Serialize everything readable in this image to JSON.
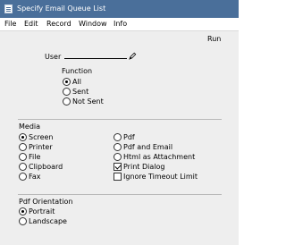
{
  "window": {
    "title": "Specify Email Queue List"
  },
  "menu": [
    "File",
    "Edit",
    "Record",
    "Window",
    "Info"
  ],
  "toolbar": {
    "run_label": "Run"
  },
  "user": {
    "label": "User",
    "value": ""
  },
  "function": {
    "label": "Function",
    "options": [
      "All",
      "Sent",
      "Not Sent"
    ],
    "selected": "All"
  },
  "media": {
    "label": "Media",
    "left_options": [
      "Screen",
      "Printer",
      "File",
      "Clipboard",
      "Fax"
    ],
    "right_options": [
      "Pdf",
      "Pdf and Email",
      "Html as Attachment"
    ],
    "selected": "Screen",
    "checkboxes": [
      {
        "label": "Print Dialog",
        "checked": true
      },
      {
        "label": "Ignore Timeout Limit",
        "checked": false
      }
    ]
  },
  "pdf_orientation": {
    "label": "Pdf Orientation",
    "options": [
      "Portrait",
      "Landscape"
    ],
    "selected": "Portrait"
  }
}
